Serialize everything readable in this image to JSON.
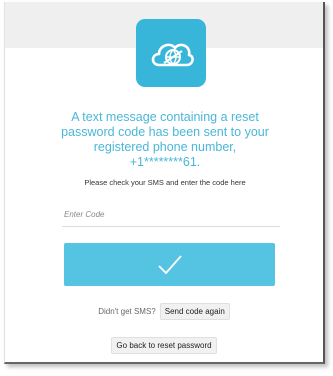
{
  "logo": {
    "icon": "cloud-globe-icon",
    "color": "#37b6d9"
  },
  "message": {
    "text": "A text message containing a reset\npassword code has been sent to your\nregistered phone number,\n+1********61.",
    "color": "#4bb7d8"
  },
  "hint": "Please check your SMS and enter the code here",
  "code_field": {
    "placeholder": "Enter Code",
    "value": ""
  },
  "submit": {
    "icon": "checkmark-icon",
    "color": "#55c3e2"
  },
  "resend": {
    "prompt": "Didn't get SMS?",
    "button_label": "Send code again"
  },
  "back": {
    "button_label": "Go back to reset password"
  }
}
